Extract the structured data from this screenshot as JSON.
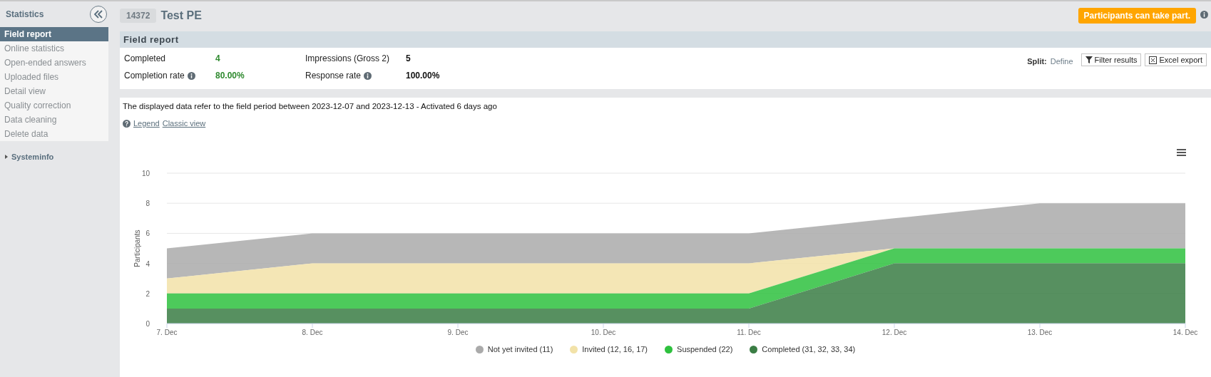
{
  "sidebar": {
    "title": "Statistics",
    "items": [
      {
        "label": "Field report",
        "selected": true
      },
      {
        "label": "Online statistics",
        "selected": false
      },
      {
        "label": "Open-ended answers",
        "selected": false
      },
      {
        "label": "Uploaded files",
        "selected": false
      },
      {
        "label": "Detail view",
        "selected": false
      },
      {
        "label": "Quality correction",
        "selected": false
      },
      {
        "label": "Data cleaning",
        "selected": false
      },
      {
        "label": "Delete data",
        "selected": false
      }
    ],
    "systeminfo": {
      "label": "Systeminfo",
      "expanded": false
    }
  },
  "header": {
    "project_id": "14372",
    "title": "Test PE",
    "status": "Participants can take part."
  },
  "field_report": {
    "title": "Field report",
    "stats": [
      {
        "label": "Completed",
        "value": "4",
        "info": false,
        "highlight": true
      },
      {
        "label": "Impressions (Gross 2)",
        "value": "5",
        "info": false,
        "highlight": false
      },
      {
        "label": "Completion rate",
        "value": "80.00%",
        "info": true,
        "highlight": true
      },
      {
        "label": "Response rate",
        "value": "100.00%",
        "info": true,
        "highlight": false
      }
    ],
    "split_label": "Split:",
    "split_link": "Define",
    "buttons": [
      "Filter results",
      "Excel export"
    ]
  },
  "chart_panel": {
    "note": "The displayed data refer to the field period between 2023-12-07 and 2023-12-13 - Activated 6 days ago",
    "links": [
      "Legend",
      "Classic view"
    ],
    "chart_data": {
      "type": "area",
      "stacked": true,
      "grid": true,
      "legend": true,
      "ylabel": "Participants",
      "categories": [
        "7. Dec",
        "8. Dec",
        "9. Dec",
        "10. Dec",
        "11. Dec",
        "12. Dec",
        "13. Dec",
        "14. Dec"
      ],
      "ylim": [
        0,
        10
      ],
      "yticks": [
        0,
        2,
        4,
        6,
        8,
        10
      ],
      "series": [
        {
          "name": "Not yet invited (11)",
          "color": "#aaaaaa",
          "values": [
            2,
            2,
            2,
            2,
            2,
            2,
            3,
            3
          ]
        },
        {
          "name": "Invited (12, 16, 17)",
          "color": "#f2e2a8",
          "values": [
            1,
            2,
            2,
            2,
            2,
            0,
            0,
            0
          ]
        },
        {
          "name": "Suspended (22)",
          "color": "#2ec13e",
          "values": [
            1,
            1,
            1,
            1,
            1,
            1,
            1,
            1
          ]
        },
        {
          "name": "Completed (31, 32, 33, 34)",
          "color": "#3a7d44",
          "values": [
            1,
            1,
            1,
            1,
            1,
            4,
            4,
            4
          ]
        }
      ]
    }
  }
}
